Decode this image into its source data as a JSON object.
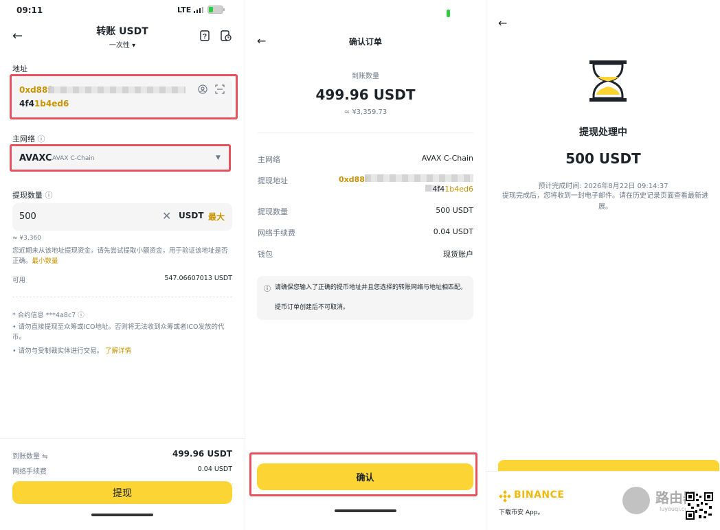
{
  "panel1": {
    "status": {
      "time": "09:11",
      "network": "LTE"
    },
    "header": {
      "title": "转账 USDT",
      "mode": "一次性"
    },
    "address": {
      "label": "地址",
      "line1_gold": "0xd88f",
      "line2_plain": "4f4",
      "line2_gold": "1b4ed6"
    },
    "network": {
      "label": "主网络",
      "value": "AVAXC",
      "sub": "AVAX C-Chain"
    },
    "amount": {
      "label": "提现数量",
      "value": "500",
      "unit": "USDT",
      "max": "最大",
      "approx": "≈ ¥3,360"
    },
    "notice": {
      "text": "您近期未从该地址提现资金。请先尝试提取小额资金，用于验证该地址是否正确。",
      "link": "最小数量"
    },
    "available": {
      "label": "可用",
      "value": "547.06607013 USDT"
    },
    "contract": {
      "line": "* 合约信息 ***4a8c7",
      "tip1": "• 请勿直接提现至众筹或ICO地址。否则将无法收到众筹或者ICO发放的代币。",
      "tip2": "• 请勿与受制裁实体进行交易。",
      "tip2_link": "了解详情"
    },
    "footer": {
      "receive_label": "到账数量",
      "receive_value": "499.96 USDT",
      "fee_label": "网络手续费",
      "fee_value": "0.04 USDT",
      "button": "提现"
    }
  },
  "panel2": {
    "title": "确认订单",
    "receive_label": "到账数量",
    "receive_amount": "499.96 USDT",
    "receive_approx": "≈ ¥3,359.73",
    "rows": {
      "network_label": "主网络",
      "network_value": "AVAX C-Chain",
      "address_label": "提现地址",
      "address_gold1": "0xd88f",
      "address_line2_plain": "4f4",
      "address_line2_gold": "1b4ed6",
      "amount_label": "提现数量",
      "amount_value": "500 USDT",
      "fee_label": "网络手续费",
      "fee_value": "0.04 USDT",
      "wallet_label": "钱包",
      "wallet_value": "现货账户"
    },
    "warning": "请确保您输入了正确的提币地址并且您选择的转账网络与地址相匹配。",
    "warning2": "提币订单创建后不可取消。",
    "confirm_button": "确认"
  },
  "panel3": {
    "status_title": "提现处理中",
    "amount": "500 USDT",
    "eta_label": "预计完成时间:",
    "eta_value": "2026年8月22日 09:14:37",
    "note": "提现完成后，您将收到一封电子邮件。请在历史记录页面查看最新进展。",
    "brand": "BINANCE",
    "download": "下载币安 App。",
    "watermark": "路由器",
    "watermark_sub": "luyouqi.com"
  },
  "colors": {
    "accent": "#fcd535",
    "gold": "#c99400",
    "highlight": "#e8505b"
  }
}
